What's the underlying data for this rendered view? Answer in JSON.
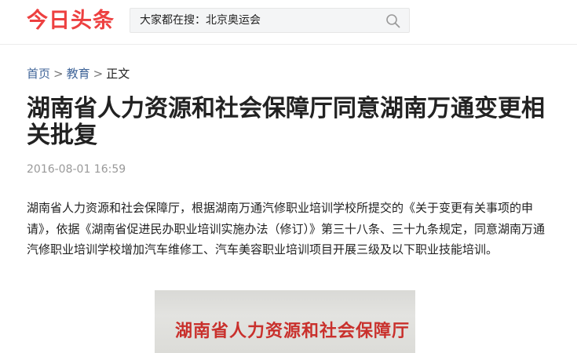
{
  "header": {
    "logo_text": "今日头条",
    "search_placeholder": "大家都在搜：北京奥运会",
    "search_button_icon": "search-icon"
  },
  "breadcrumb": {
    "home": "首页",
    "category": "教育",
    "current": "正文",
    "separator": ">"
  },
  "article": {
    "title": "湖南省人力资源和社会保障厅同意湖南万通变更相关批复",
    "timestamp": "2016-08-01 16:59",
    "paragraph": "湖南省人力资源和社会保障厅，根据湖南万通汽修职业培训学校所提交的《关于变更有关事项的申请》，依据《湖南省促进民办职业培训实施办法（修订）》第三十八条、三十九条规定，同意湖南万通汽修职业培训学校增加汽车维修工、汽车美容职业培训项目开展三级及以下职业技能培训。",
    "image_text": "湖南省人力资源和社会保障厅"
  },
  "colors": {
    "brand_red": "#ed4040",
    "link_blue": "#406599",
    "stamp_red": "#c9302c"
  }
}
